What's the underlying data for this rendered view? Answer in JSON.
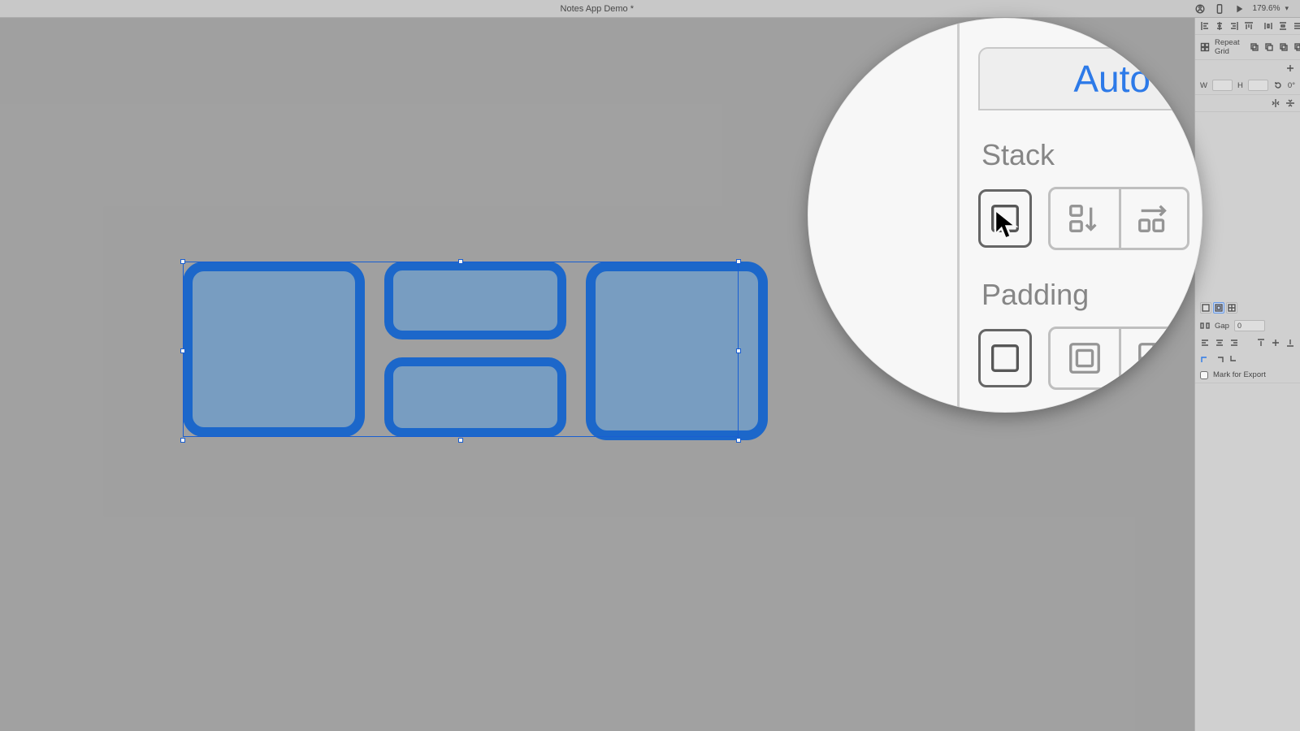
{
  "topbar": {
    "title": "Notes App Demo *",
    "zoom": "179.6%"
  },
  "inspector": {
    "repeat_grid": "Repeat Grid",
    "rotation": "0°",
    "gap_label": "Gap",
    "gap_value": "0",
    "w_label": "W",
    "h_label": "H",
    "mark_export": "Mark for Export"
  },
  "magnifier": {
    "auto_label": "Auto",
    "stack_label": "Stack",
    "padding_label": "Padding"
  }
}
